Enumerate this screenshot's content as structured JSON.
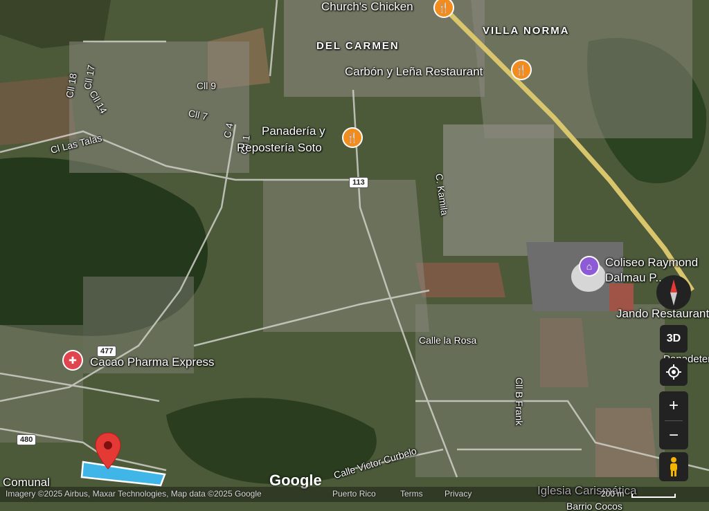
{
  "map": {
    "area_labels": [
      "VILLA NORMA",
      "DEL CARMEN"
    ],
    "streets": [
      "Cll 18",
      "Cll 17",
      "Cll 14",
      "Cll 9",
      "Cll 7",
      "C 4",
      "Cll 1",
      "Cl Las Talas",
      "C. Kamila",
      "Calle la Rosa",
      "Cll B Frank",
      "Calle Victor Curbelo"
    ],
    "route_shields": [
      "113",
      "477",
      "480"
    ],
    "pois": {
      "churchs": "Church's Chicken",
      "carbon": "Carbón y Leña Restaurant",
      "panaderia_line1": "Panadería y",
      "panaderia_line2": "Repostería Soto",
      "coliseo_line1": "Coliseo Raymond",
      "coliseo_line2": "Dalmau P...",
      "jando": "Jando Restaurant",
      "cacao": "Cacao Pharma Express",
      "comunal": "Comunal",
      "panadeteria": "Panadeteria",
      "iglesia": "Iglesia Carismática",
      "barrio": "Barrio Cocos"
    },
    "icons": {
      "restaurant": "fork-knife-icon",
      "stadium": "stadium-icon",
      "pharmacy": "pharmacy-icon",
      "pin": "map-pin-icon"
    },
    "colors": {
      "restaurant": "#f28c1e",
      "venue": "#8e5bd6",
      "pharmacy": "#e0454f",
      "highway": "#d9c56b",
      "selection": "#4fc3f7"
    }
  },
  "controls": {
    "three_d": "3D",
    "zoom_in": "+",
    "zoom_out": "−"
  },
  "footer": {
    "google_logo": "Google",
    "attribution": "Imagery ©2025 Airbus, Maxar Technologies, Map data ©2025 Google",
    "region": "Puerto Rico",
    "terms": "Terms",
    "privacy": "Privacy",
    "scale": "200 m"
  }
}
